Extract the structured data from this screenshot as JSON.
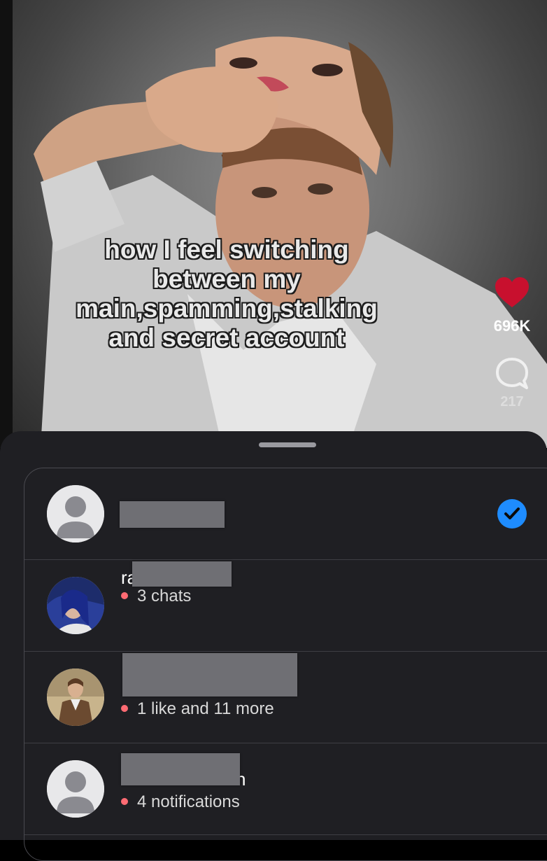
{
  "video": {
    "caption": "how I feel switching\nbetween my\nmain,spamming,stalking\nand secret account",
    "like_count": "696K",
    "comment_count": "217"
  },
  "accounts": [
    {
      "name_visible": "",
      "status": "",
      "selected": true,
      "avatar": "default-avatar"
    },
    {
      "name_visible": "ra",
      "status": "3 chats",
      "selected": false,
      "avatar": "photo-avatar"
    },
    {
      "name_visible": "",
      "status": "1 like and 11 more",
      "selected": false,
      "avatar": "photo-avatar"
    },
    {
      "name_visible": "n",
      "status": "4 notifications",
      "selected": false,
      "avatar": "default-avatar"
    }
  ],
  "colors": {
    "sheet_bg": "#1f1f23",
    "like_red": "#c8102e",
    "status_dot": "#ff6b73",
    "check_blue": "#1e8cff"
  }
}
